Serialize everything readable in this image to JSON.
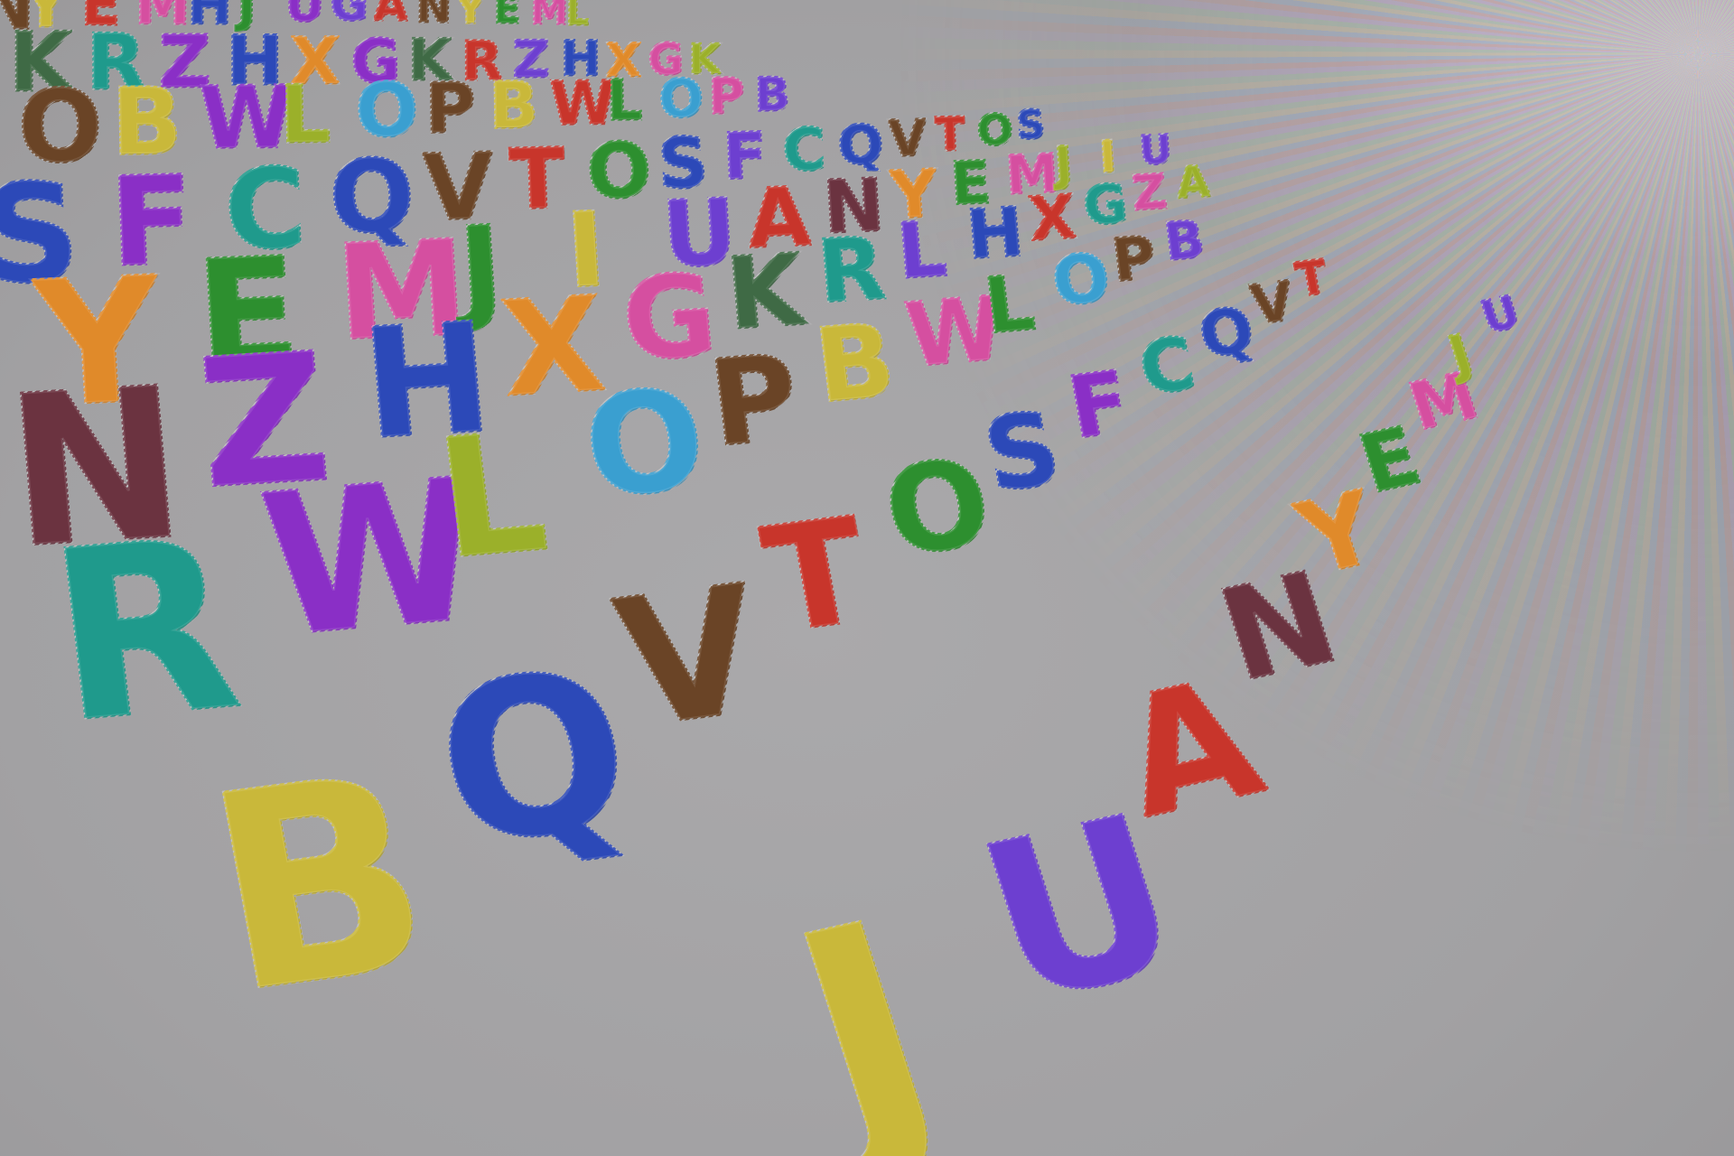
{
  "scene": {
    "background": "#a4a3a5",
    "vanishing_glow": "#efebf3"
  },
  "palette": {
    "red": "#c8352b",
    "blue": "#2c49b8",
    "teal": "#1f9a8c",
    "purple": "#8a2fc6",
    "violet": "#6d3fd0",
    "green": "#2d8f2f",
    "olive": "#9bb02a",
    "yellow": "#c9b83a",
    "orange": "#e08a2a",
    "brown": "#6a4426",
    "pink": "#d54fa0",
    "skyblue": "#3a9fd0",
    "maroon": "#6b3340",
    "darkgreen": "#3f6a45"
  },
  "rows": [
    {
      "name": "row-0",
      "items": [
        {
          "ch": "N",
          "color": "brown"
        },
        {
          "ch": "Y",
          "color": "yellow"
        },
        {
          "ch": "E",
          "color": "red"
        },
        {
          "ch": "M",
          "color": "pink"
        },
        {
          "ch": "H",
          "color": "blue"
        },
        {
          "ch": "J",
          "color": "green"
        },
        {
          "ch": "U",
          "color": "purple"
        },
        {
          "ch": "G",
          "color": "violet"
        },
        {
          "ch": "A",
          "color": "red"
        },
        {
          "ch": "N",
          "color": "brown"
        },
        {
          "ch": "Y",
          "color": "yellow"
        },
        {
          "ch": "E",
          "color": "green"
        },
        {
          "ch": "M",
          "color": "pink"
        },
        {
          "ch": "L",
          "color": "olive"
        }
      ]
    },
    {
      "name": "row-1",
      "items": [
        {
          "ch": "K",
          "color": "darkgreen"
        },
        {
          "ch": "R",
          "color": "teal"
        },
        {
          "ch": "Z",
          "color": "purple"
        },
        {
          "ch": "H",
          "color": "blue"
        },
        {
          "ch": "X",
          "color": "orange"
        },
        {
          "ch": "G",
          "color": "purple"
        },
        {
          "ch": "K",
          "color": "darkgreen"
        },
        {
          "ch": "R",
          "color": "red"
        },
        {
          "ch": "Z",
          "color": "violet"
        },
        {
          "ch": "H",
          "color": "blue"
        },
        {
          "ch": "X",
          "color": "orange"
        },
        {
          "ch": "G",
          "color": "pink"
        },
        {
          "ch": "K",
          "color": "olive"
        }
      ]
    },
    {
      "name": "row-2",
      "items": [
        {
          "ch": "O",
          "color": "brown"
        },
        {
          "ch": "B",
          "color": "yellow"
        },
        {
          "ch": "W",
          "color": "purple"
        },
        {
          "ch": "L",
          "color": "olive"
        },
        {
          "ch": "O",
          "color": "skyblue"
        },
        {
          "ch": "P",
          "color": "brown"
        },
        {
          "ch": "B",
          "color": "yellow"
        },
        {
          "ch": "W",
          "color": "red"
        },
        {
          "ch": "L",
          "color": "green"
        },
        {
          "ch": "O",
          "color": "skyblue"
        },
        {
          "ch": "P",
          "color": "pink"
        },
        {
          "ch": "B",
          "color": "violet"
        }
      ]
    },
    {
      "name": "row-3",
      "items": [
        {
          "ch": "S",
          "color": "blue"
        },
        {
          "ch": "F",
          "color": "purple"
        },
        {
          "ch": "C",
          "color": "teal"
        },
        {
          "ch": "Q",
          "color": "blue"
        },
        {
          "ch": "V",
          "color": "brown"
        },
        {
          "ch": "T",
          "color": "red"
        },
        {
          "ch": "O",
          "color": "green"
        },
        {
          "ch": "S",
          "color": "blue"
        },
        {
          "ch": "F",
          "color": "violet"
        },
        {
          "ch": "C",
          "color": "teal"
        },
        {
          "ch": "Q",
          "color": "blue"
        },
        {
          "ch": "V",
          "color": "brown"
        },
        {
          "ch": "T",
          "color": "red"
        },
        {
          "ch": "O",
          "color": "green"
        },
        {
          "ch": "S",
          "color": "blue"
        }
      ]
    },
    {
      "name": "row-4",
      "items": [
        {
          "ch": "Y",
          "color": "orange"
        },
        {
          "ch": "E",
          "color": "green"
        },
        {
          "ch": "M",
          "color": "pink"
        },
        {
          "ch": "J",
          "color": "green"
        },
        {
          "ch": "I",
          "color": "yellow"
        },
        {
          "ch": "U",
          "color": "violet"
        },
        {
          "ch": "A",
          "color": "red"
        },
        {
          "ch": "N",
          "color": "maroon"
        },
        {
          "ch": "Y",
          "color": "orange"
        },
        {
          "ch": "E",
          "color": "green"
        },
        {
          "ch": "M",
          "color": "pink"
        },
        {
          "ch": "J",
          "color": "olive"
        },
        {
          "ch": "I",
          "color": "yellow"
        },
        {
          "ch": "U",
          "color": "violet"
        }
      ]
    },
    {
      "name": "row-5",
      "items": [
        {
          "ch": "N",
          "color": "maroon"
        },
        {
          "ch": "Z",
          "color": "purple"
        },
        {
          "ch": "H",
          "color": "blue"
        },
        {
          "ch": "X",
          "color": "orange"
        },
        {
          "ch": "G",
          "color": "pink"
        },
        {
          "ch": "K",
          "color": "darkgreen"
        },
        {
          "ch": "R",
          "color": "teal"
        },
        {
          "ch": "L",
          "color": "violet"
        },
        {
          "ch": "H",
          "color": "blue"
        },
        {
          "ch": "X",
          "color": "red"
        },
        {
          "ch": "G",
          "color": "teal"
        },
        {
          "ch": "Z",
          "color": "pink"
        },
        {
          "ch": "A",
          "color": "olive"
        }
      ]
    },
    {
      "name": "row-6",
      "items": [
        {
          "ch": "R",
          "color": "teal"
        },
        {
          "ch": "W",
          "color": "purple"
        },
        {
          "ch": "L",
          "color": "olive"
        },
        {
          "ch": "O",
          "color": "skyblue"
        },
        {
          "ch": "P",
          "color": "brown"
        },
        {
          "ch": "B",
          "color": "yellow"
        },
        {
          "ch": "W",
          "color": "pink"
        },
        {
          "ch": "L",
          "color": "green"
        },
        {
          "ch": "O",
          "color": "skyblue"
        },
        {
          "ch": "P",
          "color": "brown"
        },
        {
          "ch": "B",
          "color": "violet"
        }
      ]
    },
    {
      "name": "row-7",
      "items": [
        {
          "ch": "B",
          "color": "yellow"
        },
        {
          "ch": "Q",
          "color": "blue"
        },
        {
          "ch": "V",
          "color": "brown"
        },
        {
          "ch": "T",
          "color": "red"
        },
        {
          "ch": "O",
          "color": "green"
        },
        {
          "ch": "S",
          "color": "blue"
        },
        {
          "ch": "F",
          "color": "purple"
        },
        {
          "ch": "C",
          "color": "teal"
        },
        {
          "ch": "Q",
          "color": "blue"
        },
        {
          "ch": "V",
          "color": "brown"
        },
        {
          "ch": "T",
          "color": "red"
        }
      ]
    },
    {
      "name": "row-8",
      "items": [
        {
          "ch": "J",
          "color": "yellow"
        },
        {
          "ch": "U",
          "color": "violet"
        },
        {
          "ch": "A",
          "color": "red"
        },
        {
          "ch": "N",
          "color": "maroon"
        },
        {
          "ch": "Y",
          "color": "orange"
        },
        {
          "ch": "E",
          "color": "green"
        },
        {
          "ch": "M",
          "color": "pink"
        },
        {
          "ch": "J",
          "color": "olive"
        },
        {
          "ch": "U",
          "color": "violet"
        }
      ]
    }
  ]
}
